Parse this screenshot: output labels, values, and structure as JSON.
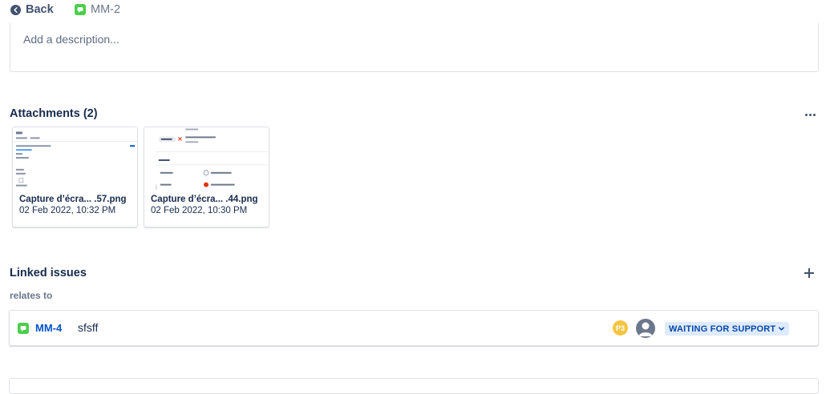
{
  "header": {
    "back_label": "Back",
    "issue_key": "MM-2"
  },
  "description": {
    "placeholder": "Add a description..."
  },
  "attachments": {
    "title": "Attachments (2)",
    "items": [
      {
        "name": "Capture d’écra... .57.png",
        "date": "02 Feb 2022, 10:32 PM"
      },
      {
        "name": "Capture d’écra... .44.png",
        "date": "02 Feb 2022, 10:30 PM"
      }
    ]
  },
  "linked_issues": {
    "title": "Linked issues",
    "relation": "relates to",
    "items": [
      {
        "key": "MM-4",
        "summary": "sfsff",
        "priority": "P3",
        "status": "WAITING FOR SUPPORT"
      }
    ]
  },
  "colors": {
    "issue_type": "#4bce4b",
    "link": "#0052cc",
    "status_bg": "#deebff",
    "status_text": "#0747a6",
    "priority": "#f5c542"
  },
  "icons": {
    "back": "arrow-left-circle-icon",
    "issue_type": "service-request-icon",
    "more": "more-horizontal-icon",
    "add": "plus-icon",
    "avatar": "user-avatar-icon",
    "status_dropdown": "chevron-down-icon"
  }
}
